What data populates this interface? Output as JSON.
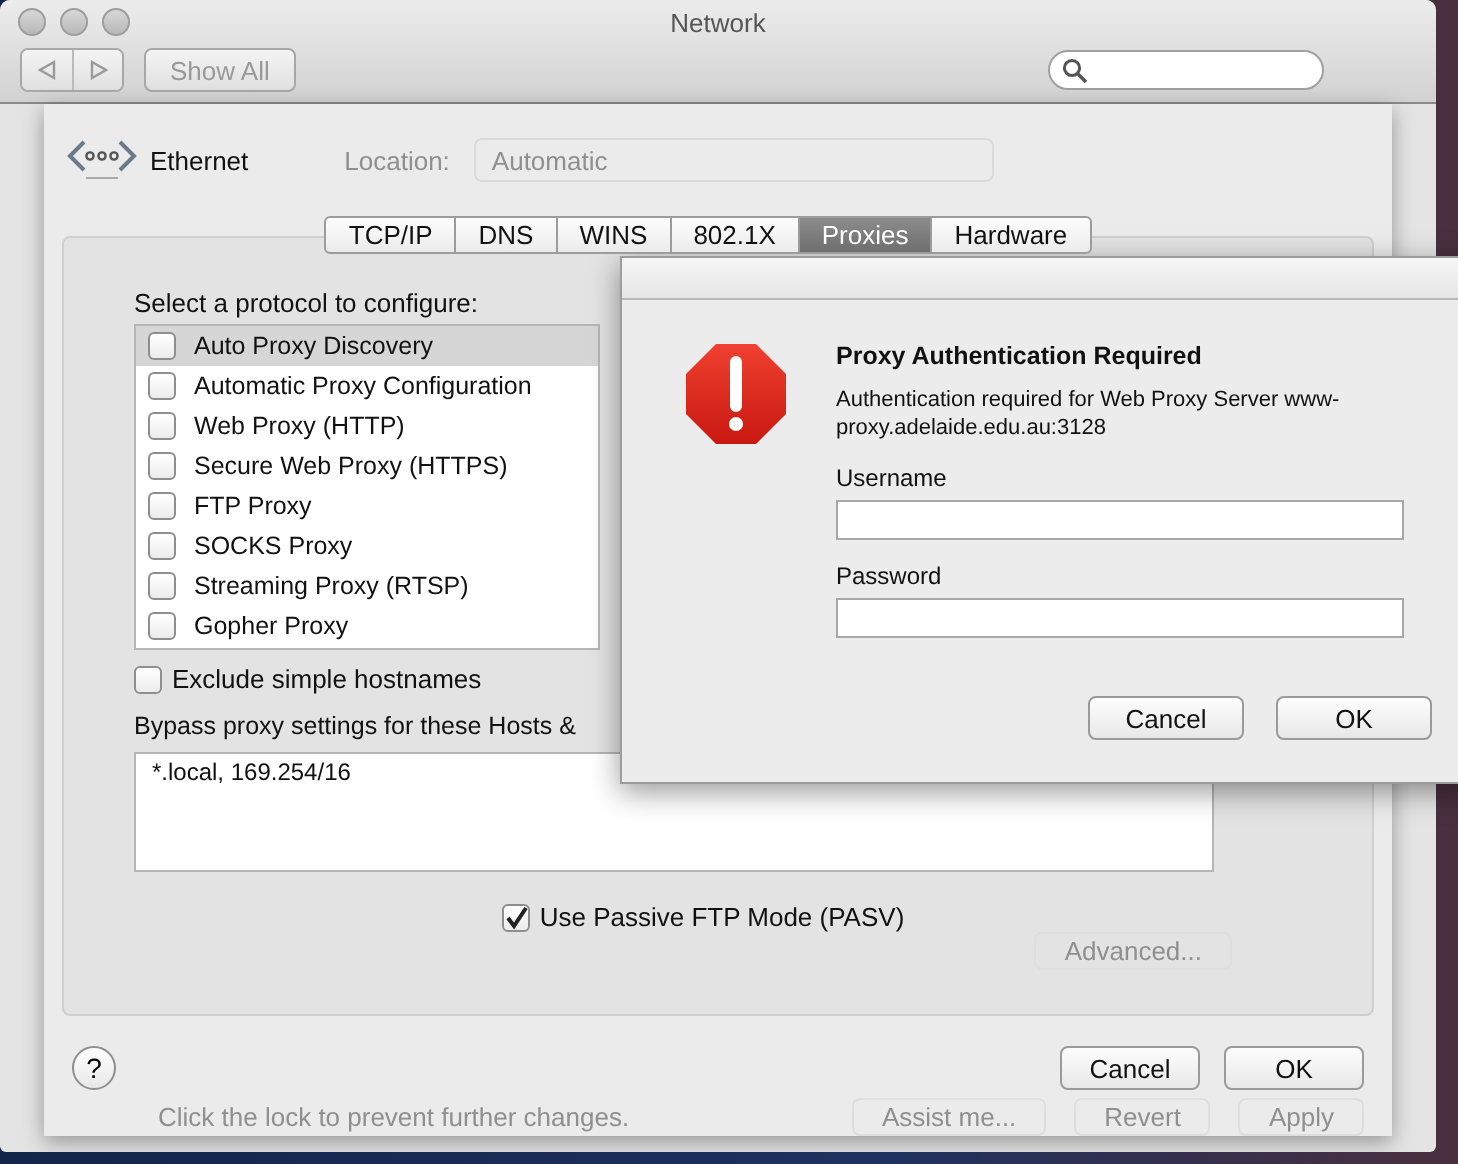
{
  "window": {
    "title": "Network"
  },
  "toolbar": {
    "show_all_button": "Show All"
  },
  "background": {
    "location_label": "Location:",
    "location_value": "Automatic",
    "advanced_button": "Advanced...",
    "lock_text": "Click the lock to prevent further changes.",
    "assist_button": "Assist me...",
    "revert_button": "Revert",
    "apply_button": "Apply"
  },
  "sheet": {
    "service": "Ethernet",
    "tabs": [
      {
        "label": "TCP/IP",
        "selected": false
      },
      {
        "label": "DNS",
        "selected": false
      },
      {
        "label": "WINS",
        "selected": false
      },
      {
        "label": "802.1X",
        "selected": false
      },
      {
        "label": "Proxies",
        "selected": true
      },
      {
        "label": "Hardware",
        "selected": false
      }
    ],
    "protocol_prompt": "Select a protocol to configure:",
    "protocols": [
      {
        "label": "Auto Proxy Discovery",
        "checked": false,
        "selected": true
      },
      {
        "label": "Automatic Proxy Configuration",
        "checked": false,
        "selected": false
      },
      {
        "label": "Web Proxy (HTTP)",
        "checked": false,
        "selected": false
      },
      {
        "label": "Secure Web Proxy (HTTPS)",
        "checked": false,
        "selected": false
      },
      {
        "label": "FTP Proxy",
        "checked": false,
        "selected": false
      },
      {
        "label": "SOCKS Proxy",
        "checked": false,
        "selected": false
      },
      {
        "label": "Streaming Proxy (RTSP)",
        "checked": false,
        "selected": false
      },
      {
        "label": "Gopher Proxy",
        "checked": false,
        "selected": false
      }
    ],
    "exclude_simple_hostnames": {
      "label": "Exclude simple hostnames",
      "checked": false
    },
    "bypass_label": "Bypass proxy settings for these Hosts &",
    "bypass_value": "*.local, 169.254/16",
    "passive_ftp": {
      "label": "Use Passive FTP Mode (PASV)",
      "checked": true
    },
    "help_button": "?",
    "buttons": [
      "Cancel",
      "OK"
    ]
  },
  "dialog": {
    "title": "Proxy Authentication Required",
    "message": "Authentication required for Web Proxy Server www-proxy.adelaide.edu.au:3128",
    "fields": [
      {
        "label": "Username"
      },
      {
        "label": "Password"
      }
    ],
    "buttons": [
      "Cancel",
      "OK"
    ]
  }
}
